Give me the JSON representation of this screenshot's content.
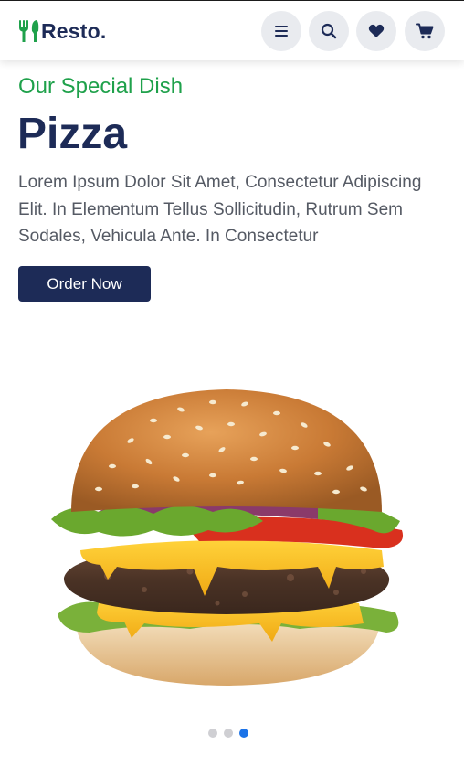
{
  "header": {
    "brand": "Resto.",
    "buttons": {
      "menu_icon": "menu-icon",
      "search_icon": "search-icon",
      "favorites_icon": "heart-icon",
      "cart_icon": "cart-icon"
    }
  },
  "hero": {
    "subtitle": "Our Special Dish",
    "title": "Pizza",
    "description": "Lorem Ipsum Dolor Sit Amet, Consectetur Adipiscing Elit. In Elementum Tellus Sollicitudin, Rutrum Sem Sodales, Vehicula Ante. In Consectetur",
    "cta_label": "Order Now",
    "image": "burger-image"
  },
  "carousel": {
    "slide_count": 3,
    "active_index": 2
  },
  "colors": {
    "primary": "#1d2b57",
    "accent_green": "#1fa14b",
    "active_dot": "#1b73e8",
    "button_bg": "#e9ebef"
  }
}
